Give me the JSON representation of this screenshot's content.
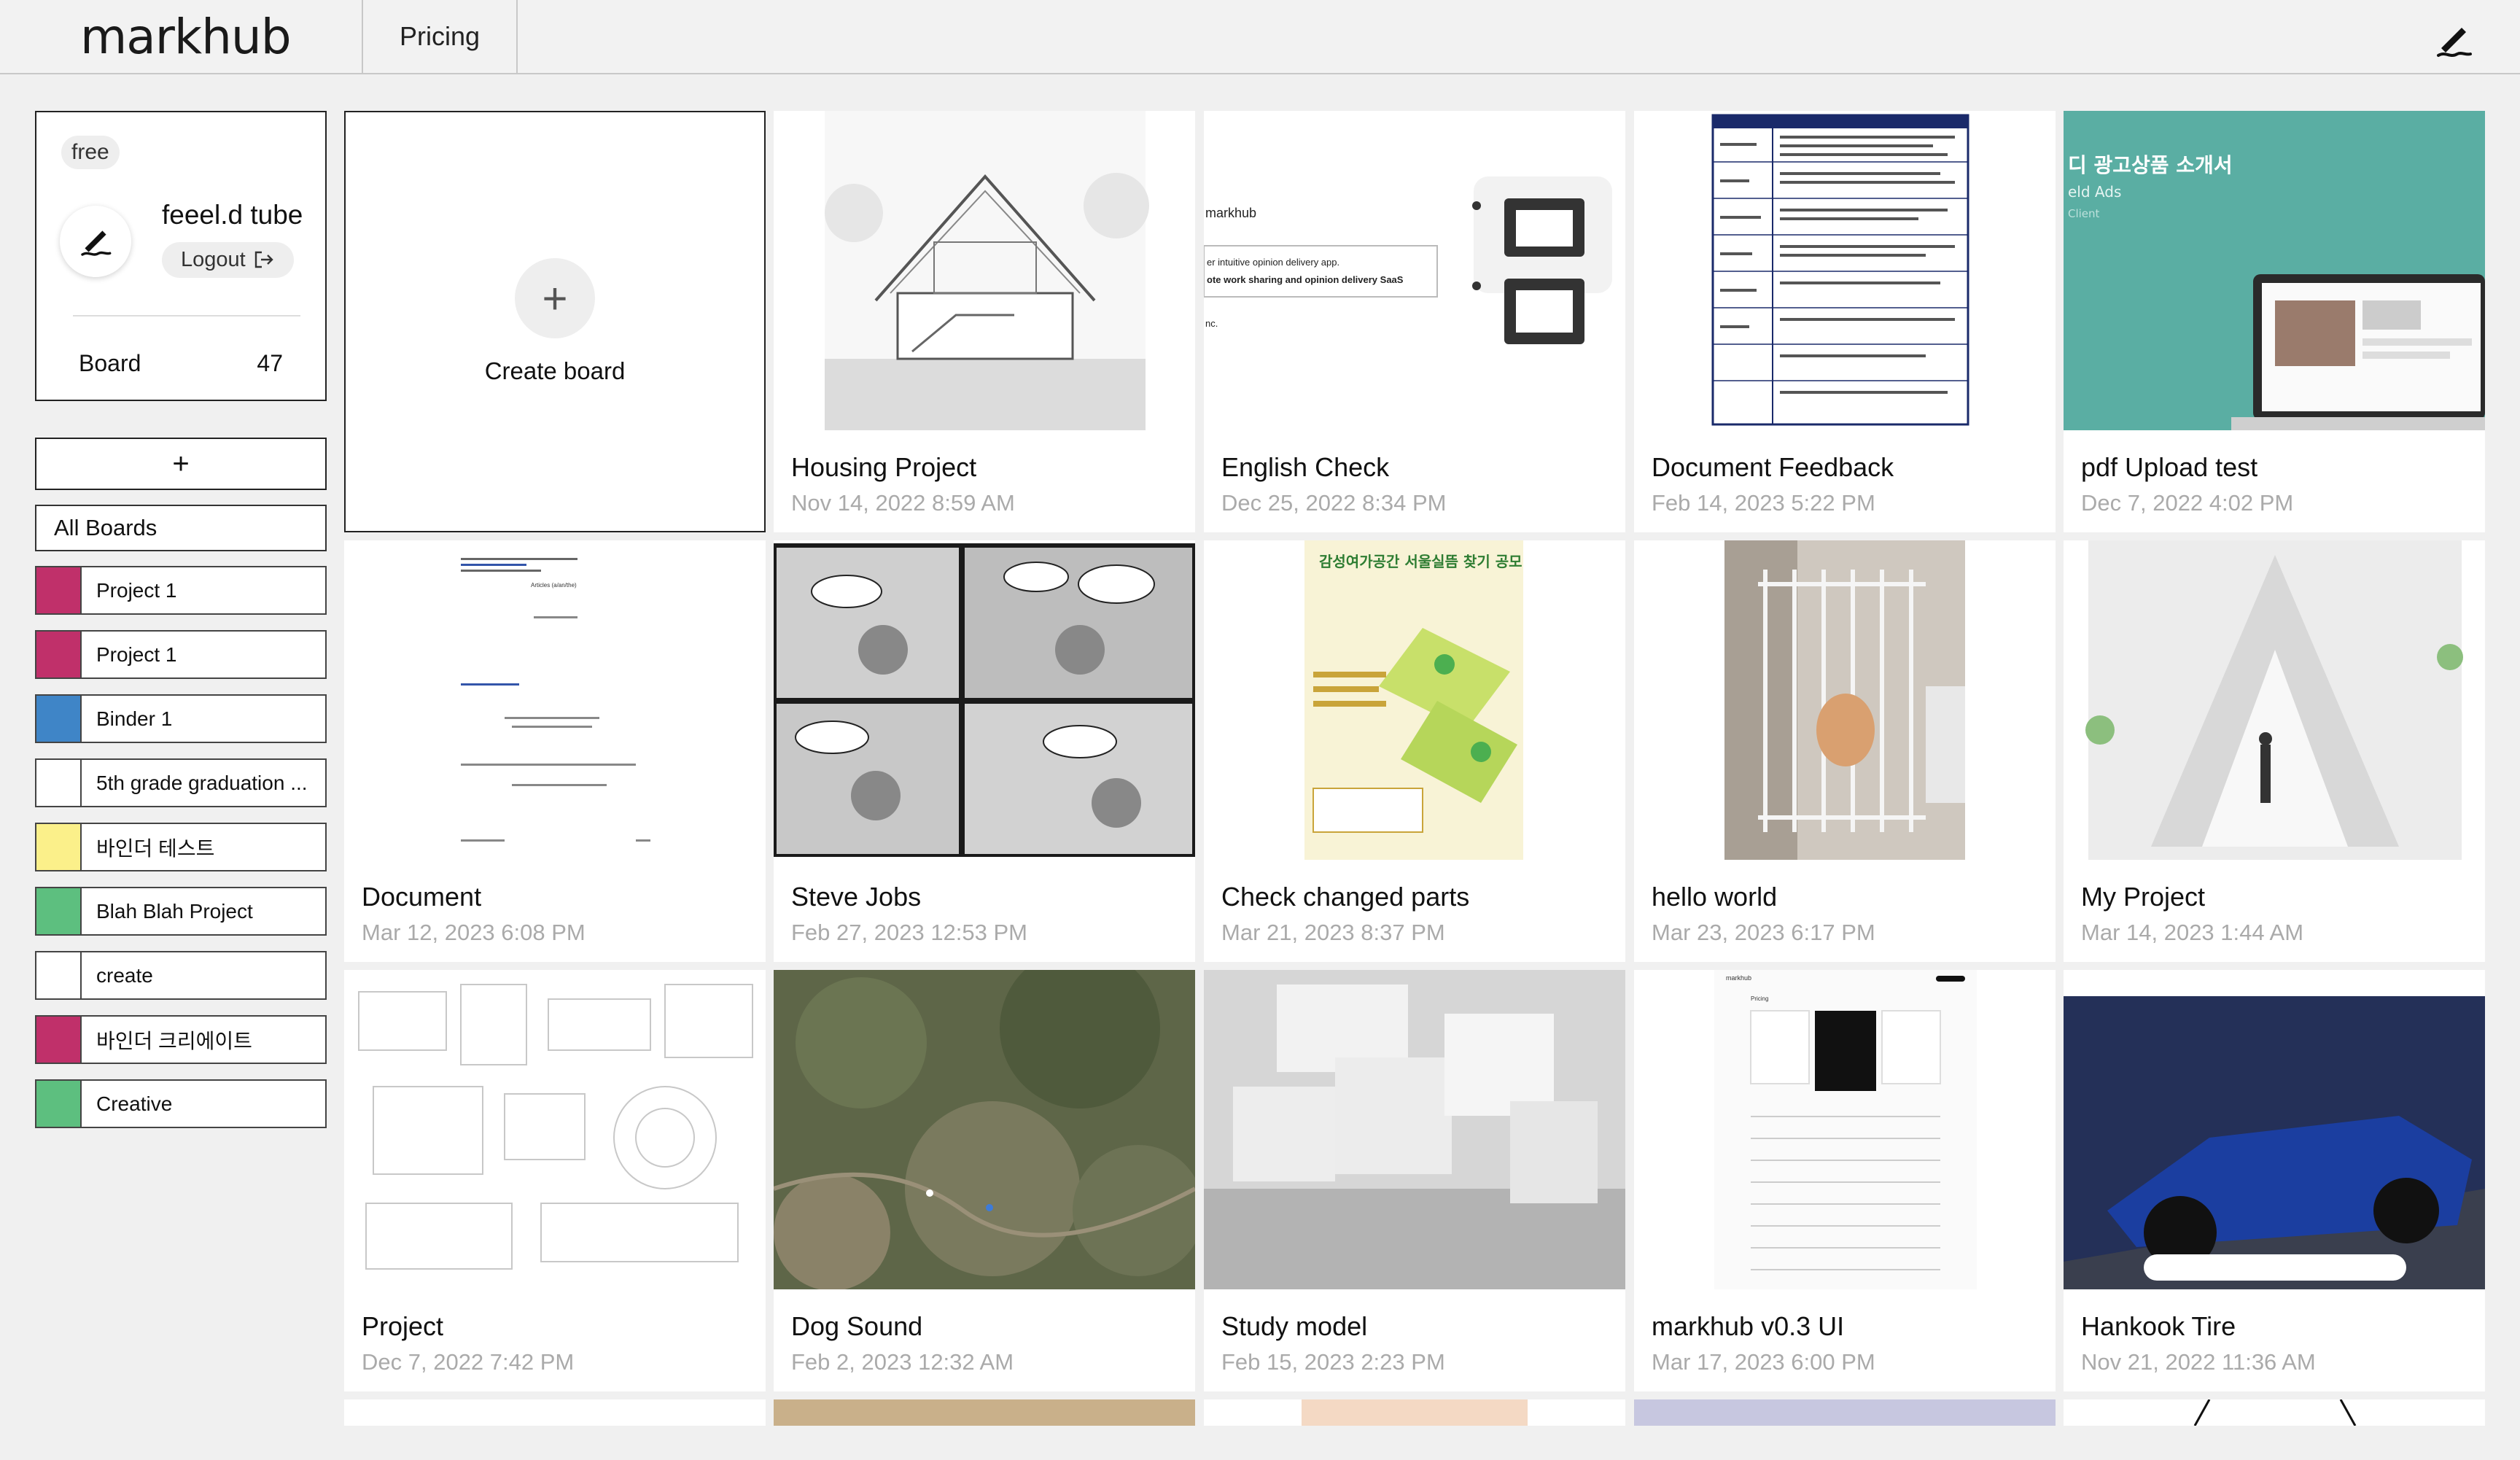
{
  "app": {
    "logo": "markhub",
    "nav_pricing": "Pricing",
    "top_icon": "pen-signature-icon"
  },
  "profile": {
    "plan": "free",
    "username": "feeel.d tube",
    "logout": "Logout",
    "board_label": "Board",
    "board_count": "47"
  },
  "sidebar": {
    "add_label": "+",
    "all_boards": "All Boards",
    "binders": [
      {
        "label": "Project 1",
        "color": "#c0306a"
      },
      {
        "label": "Project 1",
        "color": "#c0306a"
      },
      {
        "label": "Binder 1",
        "color": "#3f85c7"
      },
      {
        "label": "5th grade graduation ...",
        "color": "#ffffff"
      },
      {
        "label": "바인더 테스트",
        "color": "#fbf08a"
      },
      {
        "label": "Blah Blah Project",
        "color": "#5dbf7f"
      },
      {
        "label": "create",
        "color": "#ffffff"
      },
      {
        "label": "바인더 크리에이트",
        "color": "#c0306a"
      },
      {
        "label": "Creative",
        "color": "#5dbf7f"
      }
    ]
  },
  "create_board": {
    "icon": "plus-icon",
    "label": "Create board"
  },
  "boards": [
    {
      "title": "Housing Project",
      "date": "Nov 14, 2022 8:59 AM"
    },
    {
      "title": "English Check",
      "date": "Dec 25, 2022 8:34 PM"
    },
    {
      "title": "Document Feedback",
      "date": "Feb 14, 2023 5:22 PM"
    },
    {
      "title": "pdf Upload test",
      "date": "Dec 7, 2022 4:02 PM"
    },
    {
      "title": "Document",
      "date": "Mar 12, 2023 6:08 PM"
    },
    {
      "title": "Steve Jobs",
      "date": "Feb 27, 2023 12:53 PM"
    },
    {
      "title": "Check changed parts",
      "date": "Mar 21, 2023 8:37 PM"
    },
    {
      "title": "hello world",
      "date": "Mar 23, 2023 6:17 PM"
    },
    {
      "title": "My Project",
      "date": "Mar 14, 2023 1:44 AM"
    },
    {
      "title": "Project",
      "date": "Dec 7, 2022 7:42 PM"
    },
    {
      "title": "Dog Sound",
      "date": "Feb 2, 2023 12:32 AM"
    },
    {
      "title": "Study model",
      "date": "Feb 15, 2023 2:23 PM"
    },
    {
      "title": "markhub v0.3 UI",
      "date": "Mar 17, 2023 6:00 PM"
    },
    {
      "title": "Hankook Tire",
      "date": "Nov 21, 2022 11:36 AM"
    }
  ],
  "thumb_text": {
    "english_logo": "markhub",
    "english_line1": "er intuitive opinion delivery app.",
    "english_line2": "ote work sharing and opinion delivery SaaS",
    "english_line3": "nc.",
    "pdf_title": "디 광고상품 소개서",
    "pdf_sub": "eld Ads",
    "pdf_client": "Client",
    "check_title": "감성여가공간 서울실뜸 찾기 공모",
    "doc_heading": "Articles (a/an/the)",
    "markhub_logo": "markhub",
    "markhub_pricing": "Pricing"
  }
}
